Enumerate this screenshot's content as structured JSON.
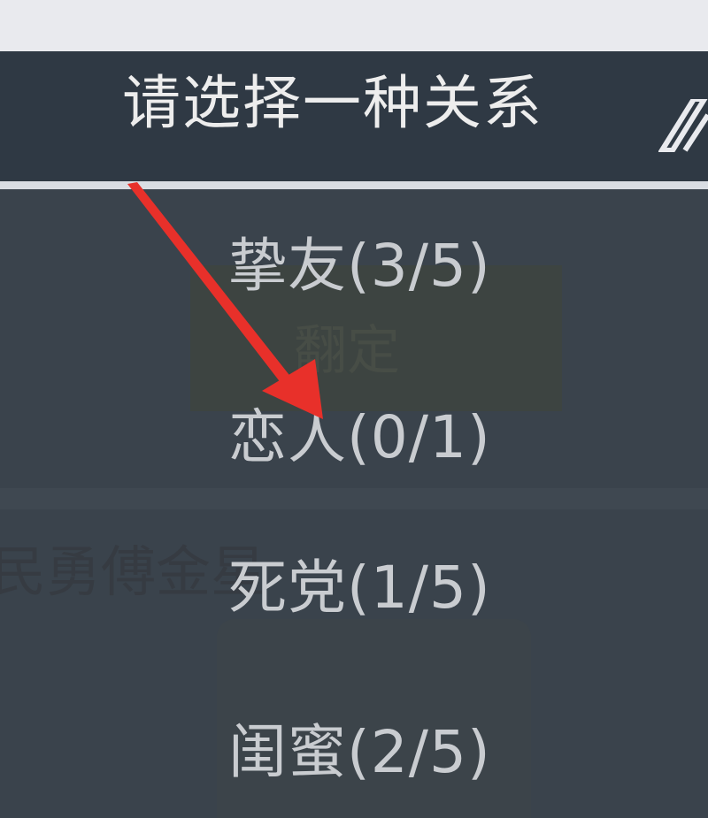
{
  "dialog": {
    "title": "请选择一种关系"
  },
  "relationships": [
    {
      "label": "挚友(3/5)"
    },
    {
      "label": "恋人(0/1)"
    },
    {
      "label": "死党(1/5)"
    },
    {
      "label": "闺蜜(2/5)"
    }
  ],
  "background": {
    "panel_text": "翻定",
    "left_text": "民勇傅金星"
  },
  "colors": {
    "header_bg": "#2f3944",
    "body_bg": "#3a434c",
    "arrow": "#e8302a",
    "text_light": "#ededed",
    "text_item": "#c9ccd0"
  }
}
